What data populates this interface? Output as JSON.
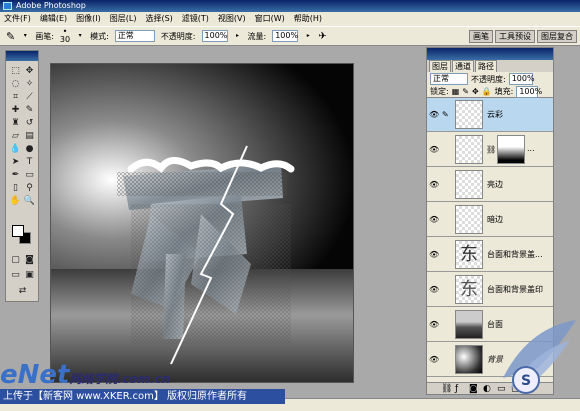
{
  "app": {
    "title": "Adobe Photoshop"
  },
  "menu": [
    "文件(F)",
    "编辑(E)",
    "图像(I)",
    "图层(L)",
    "选择(S)",
    "滤镜(T)",
    "视图(V)",
    "窗口(W)",
    "帮助(H)"
  ],
  "options": {
    "brush_label": "画笔:",
    "brush_size": "30",
    "mode_label": "模式:",
    "mode_value": "正常",
    "opacity_label": "不透明度:",
    "opacity_value": "100%",
    "flow_label": "流量:",
    "flow_value": "100%",
    "palette_tabs": [
      "画笔",
      "工具预设",
      "图层复合"
    ]
  },
  "layers_panel": {
    "tabs": [
      "图层",
      "通道",
      "路径"
    ],
    "blend_mode": "正常",
    "opacity_label": "不透明度:",
    "opacity_value": "100%",
    "lock_label": "锁定:",
    "fill_label": "填充:",
    "fill_value": "100%",
    "layers": [
      {
        "name": "云彩",
        "selected": true
      },
      {
        "name": "..."
      },
      {
        "name": "亮边"
      },
      {
        "name": "暗边"
      },
      {
        "name": "台面和背景盖..."
      },
      {
        "name": "台面和背景盖印"
      },
      {
        "name": "台面"
      },
      {
        "name": "背景"
      }
    ]
  },
  "canvas": {
    "glyph": "东"
  },
  "watermark": {
    "site": "eNet",
    "site_cn": "网络学院",
    "domain": ".com.cn",
    "banner": "上传于【新客网 www.XKER.com】 版权归原作者所有"
  },
  "colors": {
    "accent": "#0a246a",
    "selected_layer": "#b9d7ee",
    "banner": "#2d4fa0"
  }
}
